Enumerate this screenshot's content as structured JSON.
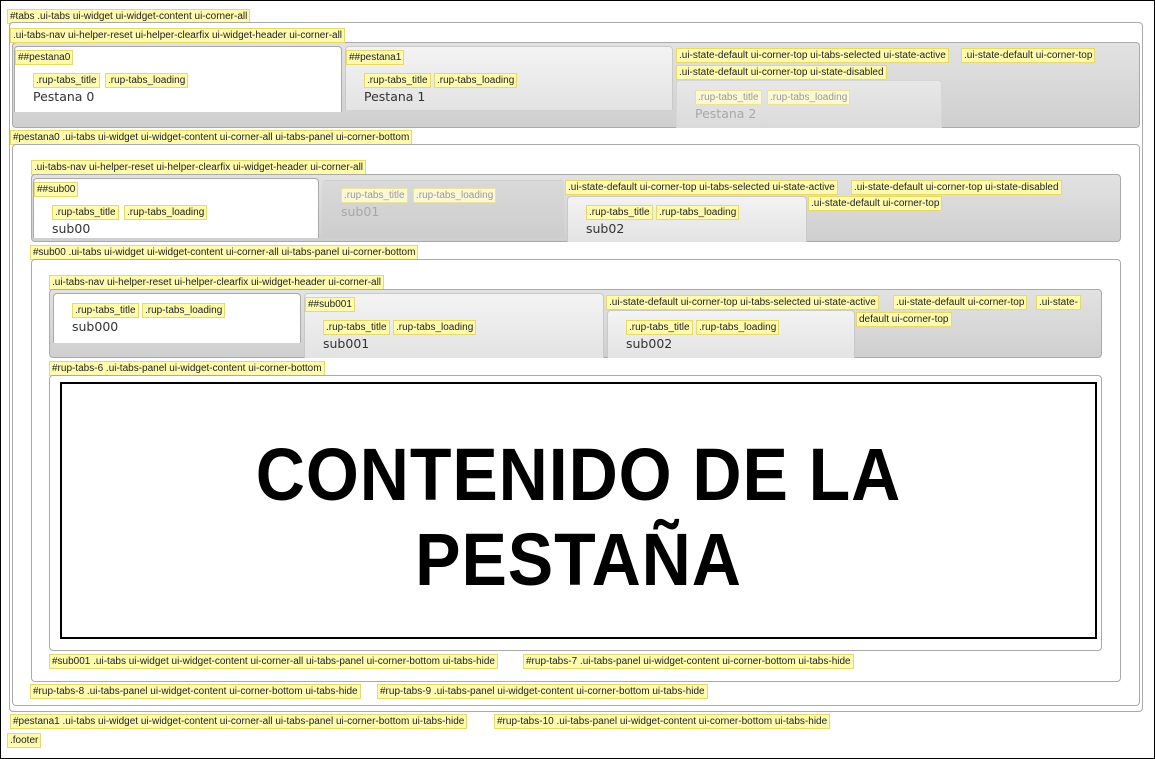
{
  "labels": {
    "tabs": "#tabs .ui-tabs ui-widget ui-widget-content ui-corner-all",
    "nav1": ".ui-tabs-nav ui-helper-reset ui-helper-clearfix ui-widget-header ui-corner-all",
    "pestana0_id": "##pestana0",
    "pestana1_id": "##pestana1",
    "state_sel_1": ".ui-state-default ui-corner-top ui-tabs-selected ui-state-active",
    "state_def_1": ".ui-state-default ui-corner-top",
    "state_dis_1": ".ui-state-default ui-corner-top ui-state-disabled",
    "panel_p0": "#pestana0 .ui-tabs ui-widget ui-widget-content ui-corner-all ui-tabs-panel ui-corner-bottom",
    "nav2": ".ui-tabs-nav ui-helper-reset ui-helper-clearfix ui-widget-header ui-corner-all",
    "sub00_id": "##sub00",
    "state_sel_2": ".ui-state-default ui-corner-top ui-tabs-selected ui-state-active",
    "state_dis_2": ".ui-state-default ui-corner-top ui-state-disabled",
    "state_def_2": ".ui-state-default ui-corner-top",
    "panel_sub00": "#sub00 .ui-tabs ui-widget ui-widget-content ui-corner-all ui-tabs-panel ui-corner-bottom",
    "nav3": ".ui-tabs-nav ui-helper-reset ui-helper-clearfix ui-widget-header ui-corner-all",
    "sub001_id": "##sub001",
    "state_sel_3": ".ui-state-default ui-corner-top ui-tabs-selected ui-state-active",
    "state_def_3": ".ui-state-default ui-corner-top",
    "state_def_3b_a": ".ui-state-",
    "state_def_3b_b": "default ui-corner-top",
    "panel_rup6": "#rup-tabs-6 .ui-tabs-panel ui-widget-content ui-corner-bottom",
    "panel_sub001": "#sub001 .ui-tabs ui-widget ui-widget-content ui-corner-all ui-tabs-panel ui-corner-bottom ui-tabs-hide",
    "panel_rup7": "#rup-tabs-7 .ui-tabs-panel ui-widget-content ui-corner-bottom ui-tabs-hide",
    "panel_rup8": "#rup-tabs-8 .ui-tabs-panel ui-widget-content ui-corner-bottom ui-tabs-hide",
    "panel_rup9": "#rup-tabs-9 .ui-tabs-panel ui-widget-content ui-corner-bottom ui-tabs-hide",
    "panel_p1": "#pestana1 .ui-tabs ui-widget ui-widget-content ui-corner-all ui-tabs-panel ui-corner-bottom ui-tabs-hide",
    "panel_rup10": "#rup-tabs-10 .ui-tabs-panel ui-widget-content ui-corner-bottom ui-tabs-hide",
    "footer": ".footer",
    "rup_title": ".rup-tabs_title",
    "rup_loading": ".rup-tabs_loading"
  },
  "tabs_level1": [
    "Pestana 0",
    "Pestana 1",
    "Pestana 2"
  ],
  "tabs_level2": [
    "sub00",
    "sub01",
    "sub02"
  ],
  "tabs_level3": [
    "sub000",
    "sub001",
    "sub002"
  ],
  "content_text": "CONTENIDO DE LA PESTAÑA",
  "state": {
    "level1_selected": "Pestana 0",
    "level1_disabled": "Pestana 2",
    "level2_selected": "sub00",
    "level2_disabled": "sub01",
    "level3_selected": "sub000"
  }
}
